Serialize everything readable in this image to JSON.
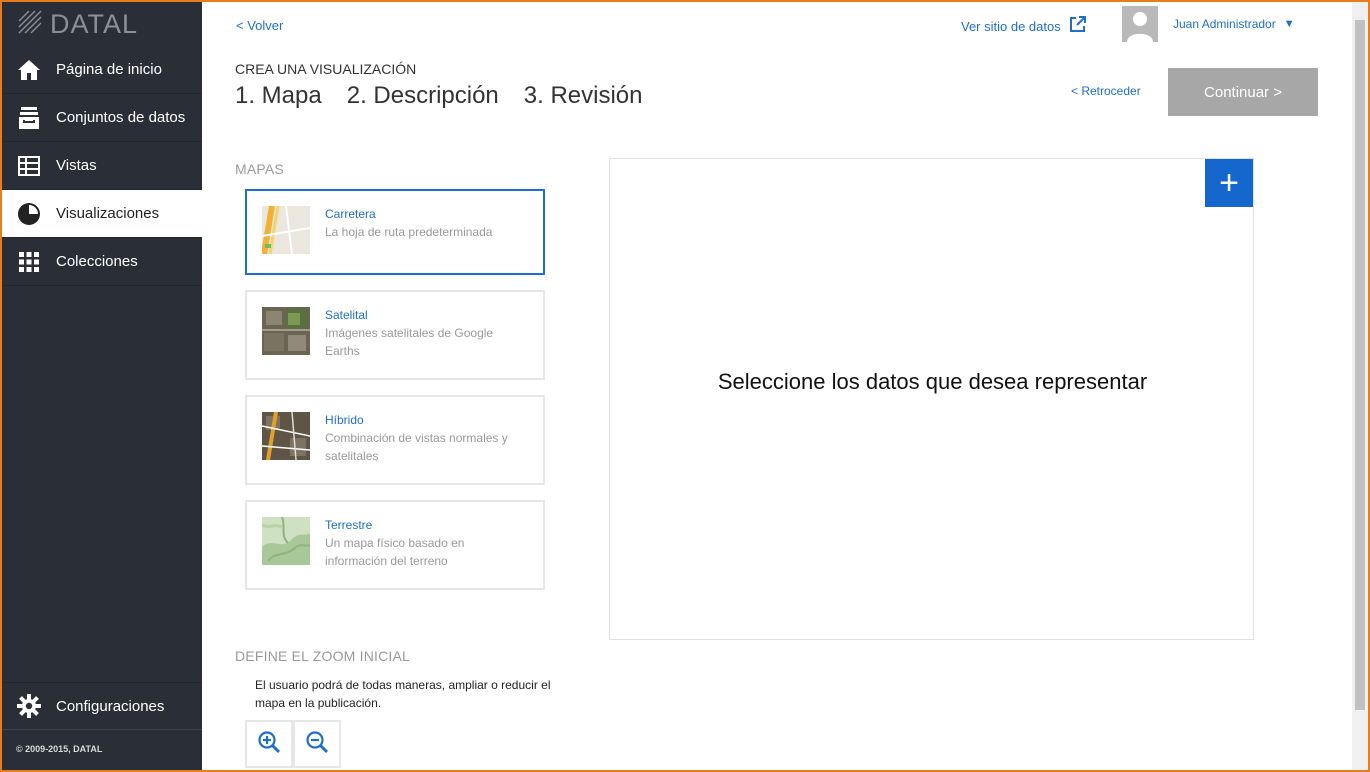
{
  "sidebar": {
    "logo": "DATAL",
    "items": [
      {
        "label": "Página de inicio",
        "icon": "home-icon",
        "active": false
      },
      {
        "label": "Conjuntos de datos",
        "icon": "inbox-icon",
        "active": false
      },
      {
        "label": "Vistas",
        "icon": "table-icon",
        "active": false
      },
      {
        "label": "Visualizaciones",
        "icon": "pie-chart-icon",
        "active": true
      },
      {
        "label": "Colecciones",
        "icon": "grid-icon",
        "active": false
      }
    ],
    "settings_label": "Configuraciones",
    "copyright": "© 2009-2015, DATAL"
  },
  "header": {
    "back_label": "< Volver",
    "site_label": "Ver sitio de datos",
    "user_name": "Juan Administrador"
  },
  "steps": {
    "caption": "CREA UNA VISUALIZACIÓN",
    "items": [
      "1. Mapa",
      "2. Descripción",
      "3. Revisión"
    ],
    "prev_label": "< Retroceder",
    "continue_label": "Continuar >"
  },
  "maps": {
    "section_label": "MAPAS",
    "items": [
      {
        "title": "Carretera",
        "desc": "La hoja de ruta predeterminada",
        "selected": true
      },
      {
        "title": "Satelital",
        "desc": "Imágenes satelitales de Google Earths",
        "selected": false
      },
      {
        "title": "Híbrido",
        "desc": "Combinación de vistas normales y satelitales",
        "selected": false
      },
      {
        "title": "Terrestre",
        "desc": "Un mapa físico basado en información del terreno",
        "selected": false
      }
    ]
  },
  "zoom": {
    "section_label": "DEFINE EL ZOOM INICIAL",
    "desc": "El usuario podrá de todas maneras, ampliar o reducir el mapa en la publicación."
  },
  "preview": {
    "add_label": "+",
    "message": "Seleccione los datos que desea representar"
  },
  "colors": {
    "accent": "#1467cc",
    "link": "#1f6fc6",
    "sidebar": "#2a2f37",
    "frame": "#e87d1e"
  }
}
